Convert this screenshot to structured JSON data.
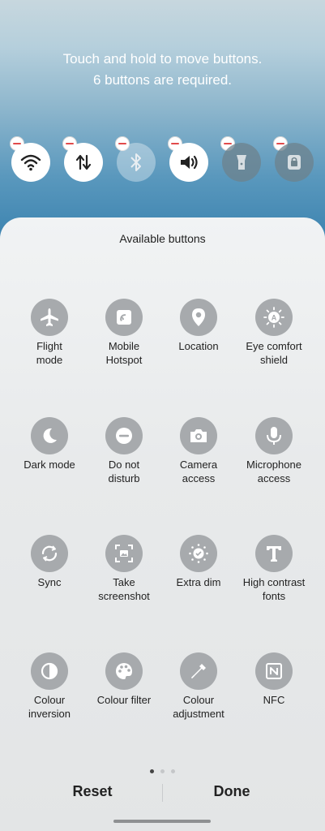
{
  "hint": {
    "line1": "Touch and hold to move buttons.",
    "line2": "6 buttons are required."
  },
  "active_buttons": [
    {
      "icon": "wifi-icon",
      "state": "on"
    },
    {
      "icon": "mobile-data-icon",
      "state": "on"
    },
    {
      "icon": "bluetooth-icon",
      "state": "off"
    },
    {
      "icon": "sound-icon",
      "state": "on"
    },
    {
      "icon": "torch-icon",
      "state": "off"
    },
    {
      "icon": "secure-folder-icon",
      "state": "off"
    }
  ],
  "sheet": {
    "title": "Available buttons",
    "items": [
      {
        "label": "Flight\nmode",
        "icon": "airplane-icon"
      },
      {
        "label": "Mobile\nHotspot",
        "icon": "hotspot-icon"
      },
      {
        "label": "Location",
        "icon": "location-pin-icon"
      },
      {
        "label": "Eye comfort\nshield",
        "icon": "eye-comfort-icon"
      },
      {
        "label": "Dark mode",
        "icon": "moon-icon"
      },
      {
        "label": "Do not\ndisturb",
        "icon": "do-not-disturb-icon"
      },
      {
        "label": "Camera\naccess",
        "icon": "camera-icon"
      },
      {
        "label": "Microphone\naccess",
        "icon": "microphone-icon"
      },
      {
        "label": "Sync",
        "icon": "sync-icon"
      },
      {
        "label": "Take\nscreenshot",
        "icon": "screenshot-icon"
      },
      {
        "label": "Extra dim",
        "icon": "extra-dim-icon"
      },
      {
        "label": "High contrast\nfonts",
        "icon": "high-contrast-font-icon"
      },
      {
        "label": "Colour\ninversion",
        "icon": "colour-inversion-icon"
      },
      {
        "label": "Colour filter",
        "icon": "palette-icon"
      },
      {
        "label": "Colour\nadjustment",
        "icon": "eyedropper-icon"
      },
      {
        "label": "NFC",
        "icon": "nfc-icon"
      }
    ]
  },
  "pager": {
    "pages": 3,
    "current": 1
  },
  "actions": {
    "reset_label": "Reset",
    "done_label": "Done"
  }
}
